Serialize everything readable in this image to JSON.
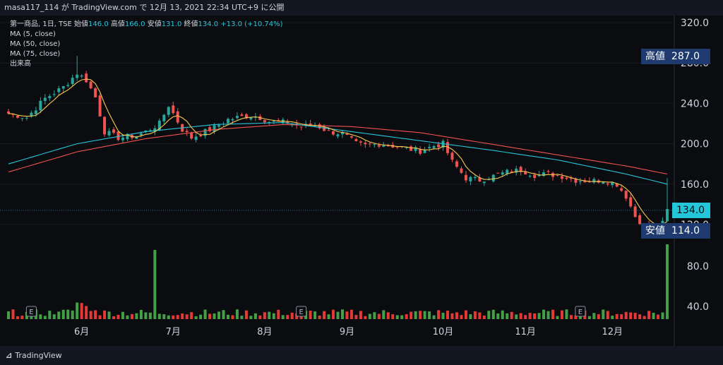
{
  "header": {
    "text": "masa117_114 が TradingView.com で 12月 13, 2021 22:34 UTC+9 に公開"
  },
  "legend": {
    "symbol": "第一商品, 1日, TSE",
    "open_label": "始値",
    "open": "146.0",
    "high_label": "高値",
    "high": "166.0",
    "low_label": "安値",
    "low": "131.0",
    "close_label": "終値",
    "close": "134.0",
    "change": "+13.0 (+10.74%)",
    "ma5": "MA (5, close)",
    "ma50": "MA (50, close)",
    "ma75": "MA (75, close)",
    "volume": "出来高"
  },
  "price_tags": {
    "high_label": "高値",
    "high_value": "287.0",
    "low_label": "安値",
    "low_value": "114.0",
    "current_value": "134.0"
  },
  "brand": "TradingView",
  "colors": {
    "up": "#26a69a",
    "down": "#ef5350",
    "ma5": "#f9c74f",
    "ma50": "#26c6da",
    "ma75": "#ef5350",
    "vol_up": "#43a047",
    "vol_down": "#e53935"
  },
  "chart_data": {
    "type": "candlestick",
    "y_ticks": [
      "320.0",
      "280.0",
      "240.0",
      "200.0",
      "160.0",
      "120.0"
    ],
    "volume_ticks": [
      "80.0",
      "40.0"
    ],
    "x_ticks": [
      "6月",
      "7月",
      "8月",
      "9月",
      "10月",
      "11月",
      "12月"
    ],
    "earnings_markers": [
      "E",
      "E",
      "E"
    ],
    "ylim": [
      112,
      328
    ],
    "price_pivots": [
      [
        0,
        230
      ],
      [
        4,
        226
      ],
      [
        8,
        245
      ],
      [
        12,
        256
      ],
      [
        15,
        270
      ],
      [
        17,
        263
      ],
      [
        19,
        246
      ],
      [
        21,
        212
      ],
      [
        24,
        206
      ],
      [
        28,
        208
      ],
      [
        30,
        212
      ],
      [
        33,
        220
      ],
      [
        35,
        238
      ],
      [
        38,
        214
      ],
      [
        40,
        206
      ],
      [
        42,
        210
      ],
      [
        45,
        216
      ],
      [
        48,
        224
      ],
      [
        50,
        226
      ],
      [
        53,
        228
      ],
      [
        55,
        226
      ],
      [
        57,
        222
      ],
      [
        61,
        221
      ],
      [
        64,
        217
      ],
      [
        67,
        219
      ],
      [
        70,
        212
      ],
      [
        73,
        210
      ],
      [
        76,
        200
      ],
      [
        78,
        198
      ],
      [
        81,
        200
      ],
      [
        84,
        198
      ],
      [
        87,
        195
      ],
      [
        90,
        193
      ],
      [
        93,
        198
      ],
      [
        95,
        200
      ],
      [
        97,
        182
      ],
      [
        100,
        166
      ],
      [
        103,
        164
      ],
      [
        106,
        168
      ],
      [
        109,
        172
      ],
      [
        112,
        174
      ],
      [
        115,
        169
      ],
      [
        118,
        170
      ],
      [
        121,
        168
      ],
      [
        124,
        164
      ],
      [
        127,
        163
      ],
      [
        130,
        164
      ],
      [
        133,
        160
      ],
      [
        135,
        148
      ],
      [
        137,
        128
      ],
      [
        139,
        119
      ],
      [
        141,
        118
      ],
      [
        143,
        121
      ],
      [
        144,
        134
      ]
    ],
    "ma50_pivots": [
      [
        0,
        180
      ],
      [
        15,
        200
      ],
      [
        30,
        212
      ],
      [
        45,
        219
      ],
      [
        60,
        221
      ],
      [
        75,
        212
      ],
      [
        90,
        203
      ],
      [
        105,
        194
      ],
      [
        120,
        184
      ],
      [
        135,
        170
      ],
      [
        144,
        160
      ]
    ],
    "ma75_pivots": [
      [
        0,
        172
      ],
      [
        15,
        192
      ],
      [
        30,
        205
      ],
      [
        45,
        214
      ],
      [
        60,
        219
      ],
      [
        75,
        217
      ],
      [
        90,
        211
      ],
      [
        105,
        200
      ],
      [
        120,
        189
      ],
      [
        135,
        178
      ],
      [
        144,
        170
      ]
    ],
    "n_days": 145
  }
}
